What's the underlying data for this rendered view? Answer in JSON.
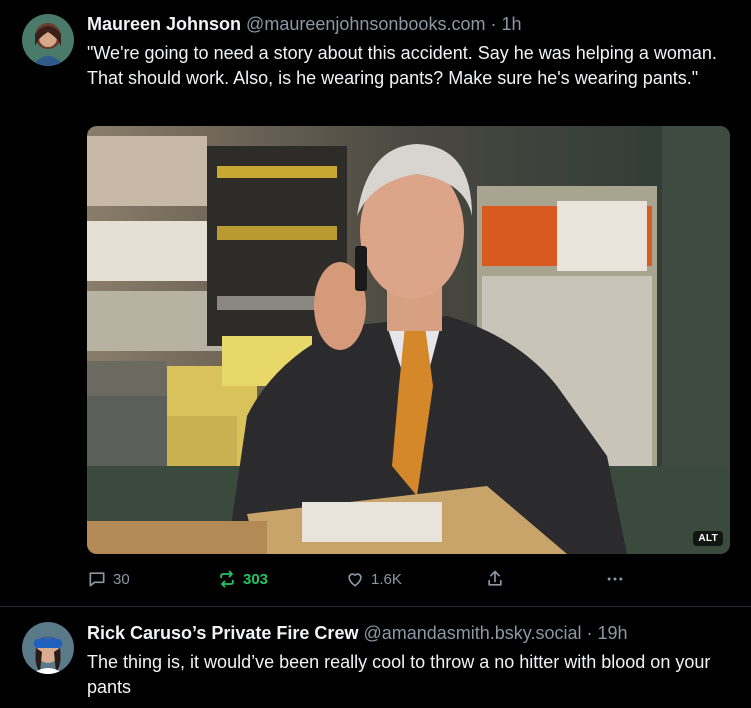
{
  "posts": [
    {
      "author": {
        "display_name": "Maureen Johnson",
        "handle": "@maureenjohnsonbooks.com",
        "time": "1h"
      },
      "text": "\"We're going to need a story about this accident. Say he was helping a woman. That should work. Also, is he wearing pants? Make sure he's wearing pants.\"",
      "media": {
        "alt_badge": "ALT"
      },
      "actions": {
        "replies": "30",
        "reposts": "303",
        "likes": "1.6K"
      }
    },
    {
      "author": {
        "display_name": "Rick Caruso’s Private Fire Crew",
        "handle": "@amandasmith.bsky.social",
        "time": "19h"
      },
      "text": "The thing is, it would’ve been really cool to throw a no hitter with blood on your pants"
    }
  ],
  "separator": "·",
  "colors": {
    "background": "#000000",
    "text": "#f1f3f5",
    "muted": "#8b98a5",
    "repost_active": "#23c562",
    "divider": "#2a2f35"
  },
  "icons": [
    "reply-icon",
    "repost-icon",
    "like-icon",
    "share-icon",
    "more-icon"
  ]
}
